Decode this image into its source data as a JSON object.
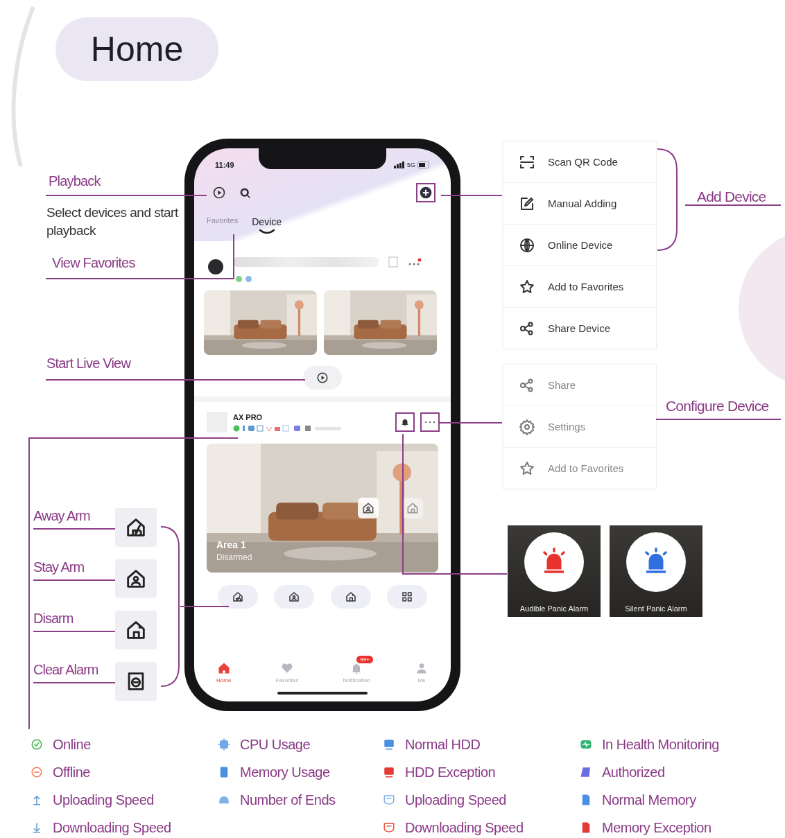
{
  "title": "Home",
  "playback": {
    "label": "Playback",
    "description": "Select devices and start playback"
  },
  "view_favorites": "View Favorites",
  "start_live_view": "Start Live View",
  "arm_actions": [
    {
      "label": "Away Arm",
      "kind": "away"
    },
    {
      "label": "Stay Arm",
      "kind": "stay"
    },
    {
      "label": "Disarm",
      "kind": "disarm"
    },
    {
      "label": "Clear  Alarm",
      "kind": "clear"
    }
  ],
  "phone": {
    "time": "11:49",
    "network": "5G",
    "tabs": [
      {
        "label": "Favorites",
        "selected": false
      },
      {
        "label": "Device",
        "selected": true
      }
    ],
    "device": {
      "name": "AX PRO"
    },
    "area": {
      "name": "Area 1",
      "status": "Disarmed"
    },
    "area_actions": [
      {
        "kind": "away"
      },
      {
        "kind": "stay"
      },
      {
        "kind": "disarm"
      },
      {
        "kind": "grid"
      }
    ],
    "bottom_tabs": [
      {
        "label": "Home",
        "kind": "home",
        "selected": true
      },
      {
        "label": "Favorites",
        "kind": "heart",
        "selected": false
      },
      {
        "label": "Notification",
        "kind": "bell",
        "selected": false,
        "badge": "99+"
      },
      {
        "label": "Me",
        "kind": "person",
        "selected": false
      }
    ]
  },
  "add_device": {
    "label": "Add Device",
    "items": [
      {
        "label": "Scan QR Code",
        "kind": "scan"
      },
      {
        "label": "Manual Adding",
        "kind": "edit"
      },
      {
        "label": "Online Device",
        "kind": "globe"
      },
      {
        "label": "Add to Favorites",
        "kind": "star"
      },
      {
        "label": "Share Device",
        "kind": "share"
      }
    ]
  },
  "configure_device": {
    "label": "Configure Device",
    "items": [
      {
        "label": "Share",
        "kind": "share"
      },
      {
        "label": "Settings",
        "kind": "gear"
      },
      {
        "label": "Add to Favorites",
        "kind": "star"
      }
    ]
  },
  "panic_alarms": [
    {
      "label": "Audible Panic Alarm",
      "color": "#e8322e"
    },
    {
      "label": "Silent Panic Alarm",
      "color": "#2f6fe0"
    }
  ],
  "legend": [
    [
      {
        "label": "Online",
        "kind": "check",
        "color": "#3cb44b"
      },
      {
        "label": "Offline",
        "kind": "minus",
        "color": "#f07a5a"
      },
      {
        "label": "Uploading Speed",
        "kind": "up",
        "color": "#5b9bd5"
      },
      {
        "label": "Downloading Speed",
        "kind": "down",
        "color": "#5b9bd5"
      }
    ],
    [
      {
        "label": "CPU Usage",
        "kind": "chip",
        "color": "#6fa8e8"
      },
      {
        "label": "Memory Usage",
        "kind": "doc",
        "color": "#4a8fe0"
      },
      {
        "label": "Number of Ends",
        "kind": "ends",
        "color": "#7fb3e8"
      }
    ],
    [
      {
        "label": "Normal HDD",
        "kind": "hdd",
        "color": "#4a8fe0"
      },
      {
        "label": "HDD Exception",
        "kind": "hdd",
        "color": "#e53935"
      },
      {
        "label": "Uploading Speed",
        "kind": "tray",
        "color": "#7fb3e8"
      },
      {
        "label": "Downloading Speed",
        "kind": "tray",
        "color": "#e5533d"
      }
    ],
    [
      {
        "label": "In Health Monitoring",
        "kind": "health",
        "color": "#2fb574"
      },
      {
        "label": "Authorized",
        "kind": "auth",
        "color": "#6a6fe0"
      },
      {
        "label": "Normal Memory",
        "kind": "mem",
        "color": "#4a8fe0"
      },
      {
        "label": "Memory Exception",
        "kind": "mem",
        "color": "#e53935"
      }
    ]
  ]
}
